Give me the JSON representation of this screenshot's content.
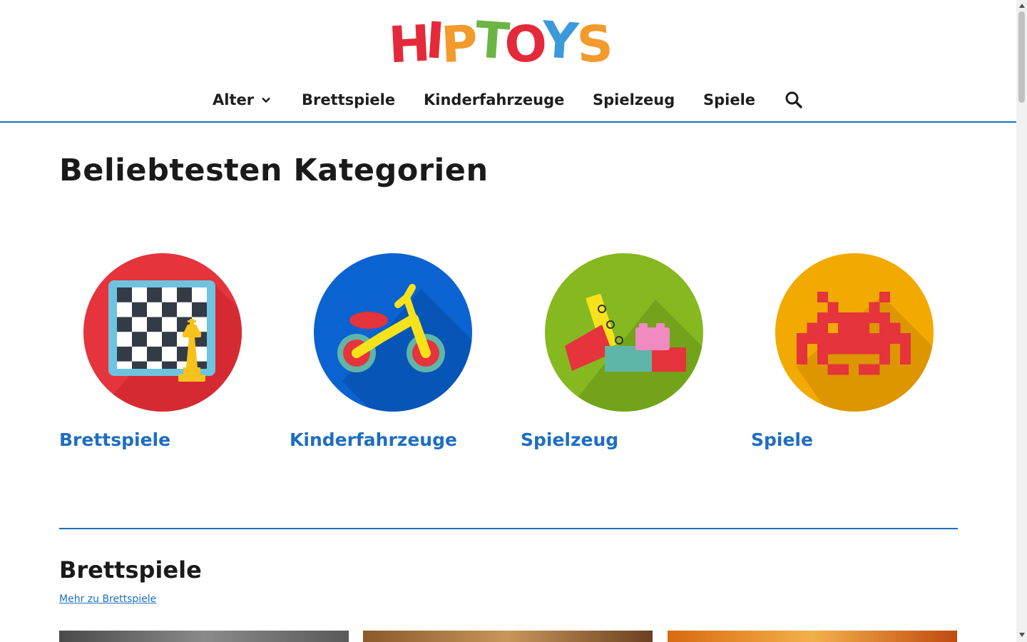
{
  "brand": {
    "logo_letters": [
      "H",
      "I",
      "P",
      "T",
      "O",
      "Y",
      "S"
    ],
    "logo_colors": [
      "#e42a3a",
      "#e42a3a",
      "#f39a2d",
      "#6bb543",
      "#e42a3a",
      "#3b9ad9",
      "#f39a2d"
    ]
  },
  "nav": {
    "items": [
      {
        "label": "Alter"
      },
      {
        "label": "Brettspiele"
      },
      {
        "label": "Kinderfahrzeuge"
      },
      {
        "label": "Spielzeug"
      },
      {
        "label": "Spiele"
      }
    ],
    "icons": {
      "dropdown": "chevron-down-icon",
      "search": "search-icon"
    }
  },
  "main": {
    "heading": "Beliebtesten Kategorien",
    "categories": [
      {
        "label": "Brettspiele",
        "icon": "chessboard-icon",
        "color": "#e5343b"
      },
      {
        "label": "Kinderfahrzeuge",
        "icon": "balance-bike-icon",
        "color": "#0a63d1"
      },
      {
        "label": "Spielzeug",
        "icon": "building-blocks-icon",
        "color": "#86b820"
      },
      {
        "label": "Spiele",
        "icon": "space-invader-icon",
        "color": "#f2a900"
      }
    ]
  },
  "section": {
    "title": "Brettspiele",
    "more_link": "Mehr zu Brettspiele"
  },
  "colors": {
    "accent": "#1e6ec0",
    "text": "#1a1a1a"
  }
}
